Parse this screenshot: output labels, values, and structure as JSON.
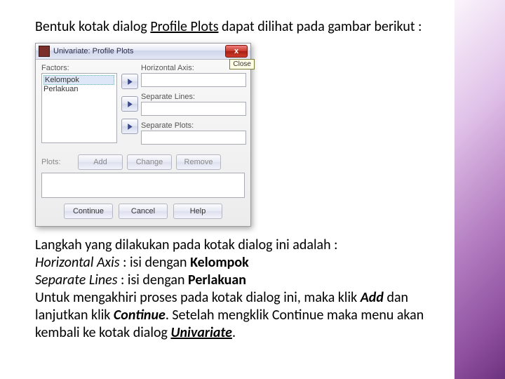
{
  "intro": {
    "pre": "Bentuk kotak dialog ",
    "underlined": "Profile Plots",
    "post": " dapat dilihat pada gambar berikut :"
  },
  "dialog": {
    "title": "Univariate: Profile Plots",
    "close_x": "x",
    "close_tooltip": "Close",
    "labels": {
      "factors": "Factors:",
      "horizontal_axis": "Horizontal Axis:",
      "separate_lines": "Separate Lines:",
      "separate_plots": "Separate Plots:",
      "plots": "Plots:"
    },
    "factors_items": [
      "Kelompok",
      "Perlakuan"
    ],
    "buttons": {
      "add": "Add",
      "change": "Change",
      "remove": "Remove",
      "continue": "Continue",
      "cancel": "Cancel",
      "help": "Help"
    }
  },
  "after": {
    "line1": "Langkah yang dilakukan pada kotak dialog ini adalah :",
    "ha_label": "Horizontal Axis",
    "ha_text": "  : isi dengan ",
    "ha_bold": "Kelompok",
    "sl_label": "Separate Lines",
    "sl_text": "   : isi dengan ",
    "sl_bold": "Perlakuan",
    "p1a": "Untuk mengakhiri proses pada kotak dialog ini, maka klik ",
    "p1b": "Add",
    "p2a": " dan lanjutkan klik ",
    "p2b": "Continue",
    "p2c": ". Setelah mengklik Continue maka menu akan kembali ke kotak dialog ",
    "p2d": "Univariate",
    "p2e": "."
  }
}
